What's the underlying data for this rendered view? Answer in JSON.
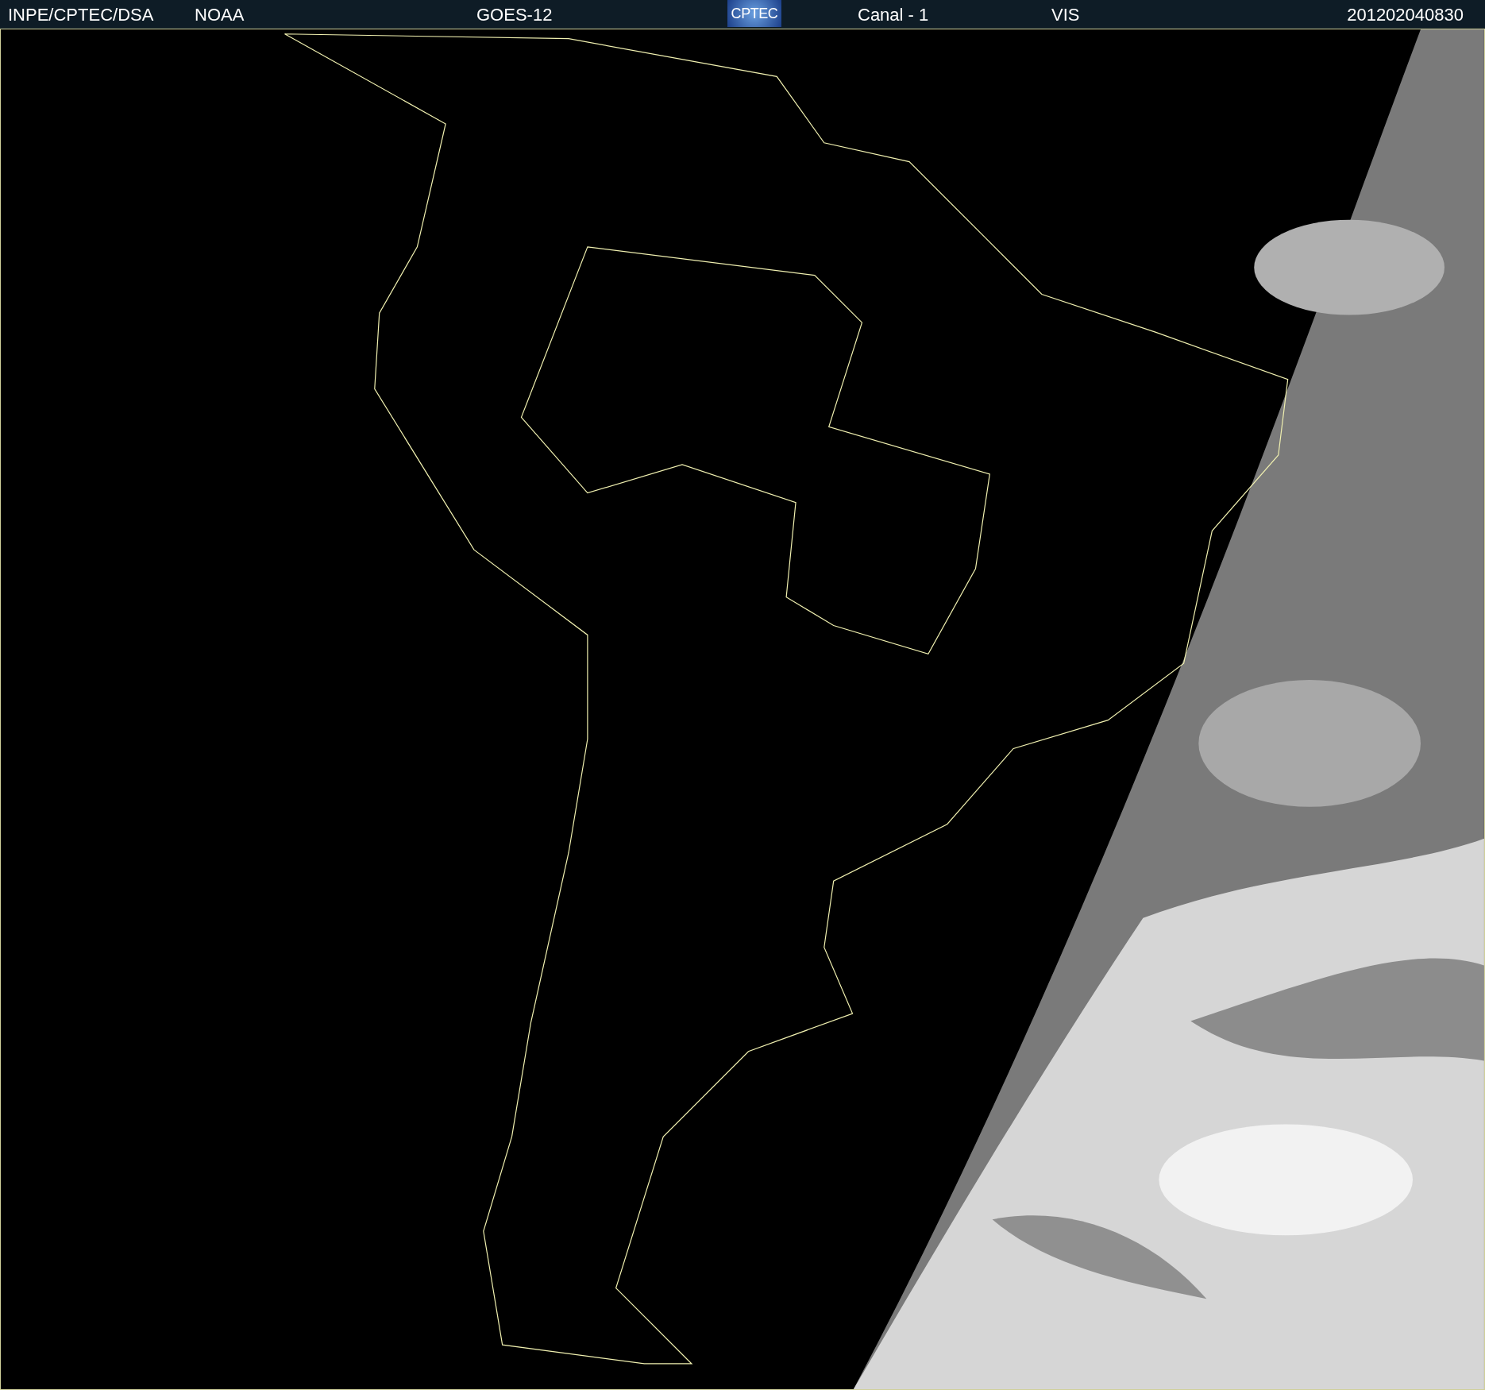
{
  "header": {
    "source": "INPE/CPTEC/DSA",
    "agency": "NOAA",
    "satellite": "GOES-12",
    "logo": "CPTEC",
    "channel": "Canal - 1",
    "band": "VIS",
    "timestamp": "201202040830"
  }
}
